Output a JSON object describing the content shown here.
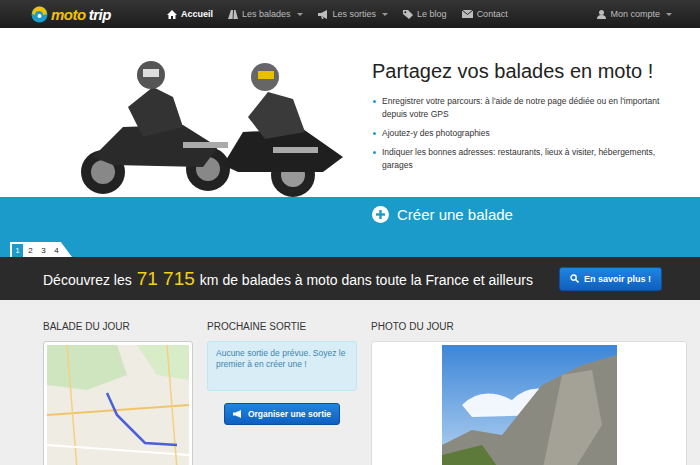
{
  "navbar": {
    "logo": {
      "first": "moto",
      "second": "trip"
    },
    "items": [
      {
        "label": "Accueil",
        "selected": true,
        "dropdown": false
      },
      {
        "label": "Les balades",
        "selected": false,
        "dropdown": true
      },
      {
        "label": "Les sorties",
        "selected": false,
        "dropdown": true
      },
      {
        "label": "Le blog",
        "selected": false,
        "dropdown": false
      },
      {
        "label": "Contact",
        "selected": false,
        "dropdown": false
      }
    ],
    "account": {
      "label": "Mon compte",
      "dropdown": true
    }
  },
  "hero": {
    "title": "Partagez vos balades en moto !",
    "bullets": [
      "Enregistrer votre parcours: à l'aide de notre page dédiée ou en l'important depuis votre GPS",
      "Ajoutez-y des photographies",
      "Indiquer les bonnes adresses: restaurants, lieux à visiter, hébergements, garages"
    ],
    "create_button": "Créer une balade",
    "slides": [
      {
        "label": "1",
        "selected": true
      },
      {
        "label": "2",
        "selected": false
      },
      {
        "label": "3",
        "selected": false
      },
      {
        "label": "4",
        "selected": false
      }
    ]
  },
  "banner": {
    "before": "Découvrez les",
    "count": "71 715",
    "after": "km de balades à moto dans toute la France et ailleurs",
    "button": "En savoir plus !"
  },
  "panels": {
    "ride_of_day": {
      "title": "BALADE DU JOUR"
    },
    "next_outing": {
      "title": "PROCHAINE SORTIE",
      "message": "Aucune sortie de prévue. Soyez le premier à en créer une !",
      "button": "Organiser une sortie"
    },
    "photo_of_day": {
      "title": "PHOTO DU JOUR"
    }
  }
}
